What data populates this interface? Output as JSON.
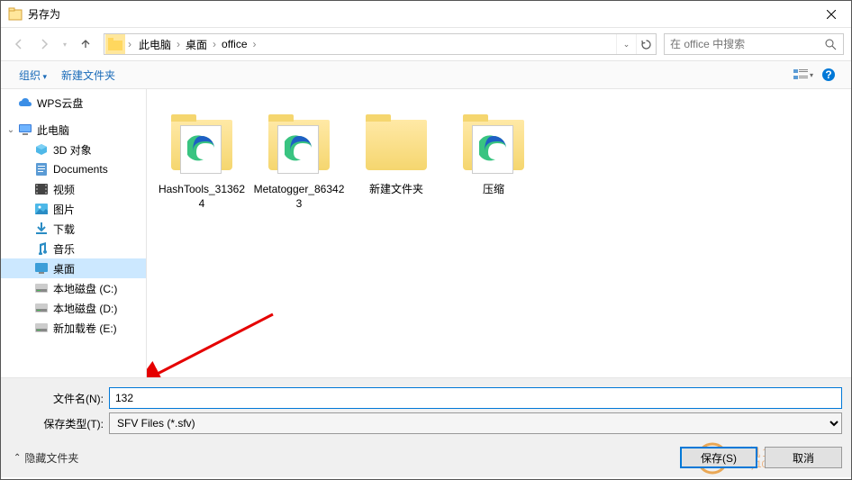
{
  "title": "另存为",
  "breadcrumb": {
    "items": [
      "此电脑",
      "桌面",
      "office"
    ]
  },
  "search": {
    "placeholder": "在 office 中搜索"
  },
  "toolbar": {
    "organize": "组织",
    "new_folder": "新建文件夹"
  },
  "sidebar": {
    "wps": "WPS云盘",
    "this_pc": "此电脑",
    "items": [
      "3D 对象",
      "Documents",
      "视频",
      "图片",
      "下载",
      "音乐",
      "桌面",
      "本地磁盘 (C:)",
      "本地磁盘 (D:)",
      "新加载卷 (E:)"
    ]
  },
  "files": [
    {
      "name": "HashTools_313624",
      "type": "folder-app"
    },
    {
      "name": "Metatogger_863423",
      "type": "folder-app"
    },
    {
      "name": "新建文件夹",
      "type": "folder-empty"
    },
    {
      "name": "压缩",
      "type": "folder-app"
    }
  ],
  "bottom": {
    "filename_label": "文件名(N):",
    "filename_value": "132",
    "filetype_label": "保存类型(T):",
    "filetype_value": "SFV Files (*.sfv)",
    "hide_folders": "隐藏文件夹",
    "save": "保存(S)",
    "cancel": "取消"
  },
  "watermark": {
    "cn": "单机100网",
    "url": "danji100.com"
  }
}
